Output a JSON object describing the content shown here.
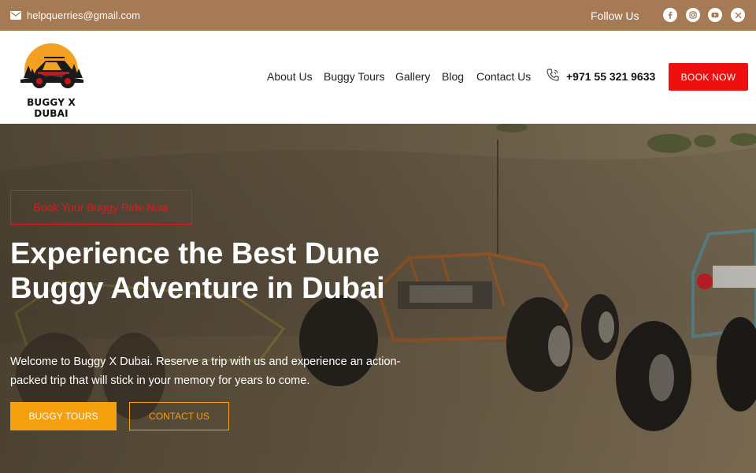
{
  "topbar": {
    "email": "helpquerries@gmail.com",
    "follow_label": "Follow Us",
    "social_icons": [
      "facebook-icon",
      "instagram-icon",
      "youtube-icon",
      "x-icon"
    ]
  },
  "header": {
    "logo_text": "BUGGY X DUBAI",
    "nav": [
      "About Us",
      "Buggy Tours",
      "Gallery",
      "Blog",
      "Contact Us"
    ],
    "phone": "+971 55 321 9633",
    "book_now": "BOOK NOW"
  },
  "hero": {
    "tag": "Book Your Buggy Ride Now",
    "title": "Experience the Best Dune Buggy Adventure in Dubai",
    "text": "Welcome to Buggy X Dubai. Reserve a trip with us and experience an action-packed trip that will stick in your memory for years to come.",
    "btn_tours": "BUGGY TOURS",
    "btn_contact": "CONTACT US"
  },
  "colors": {
    "topbar": "#a57a55",
    "accent_red": "#ee0f0f",
    "accent_orange": "#f4a00f"
  }
}
